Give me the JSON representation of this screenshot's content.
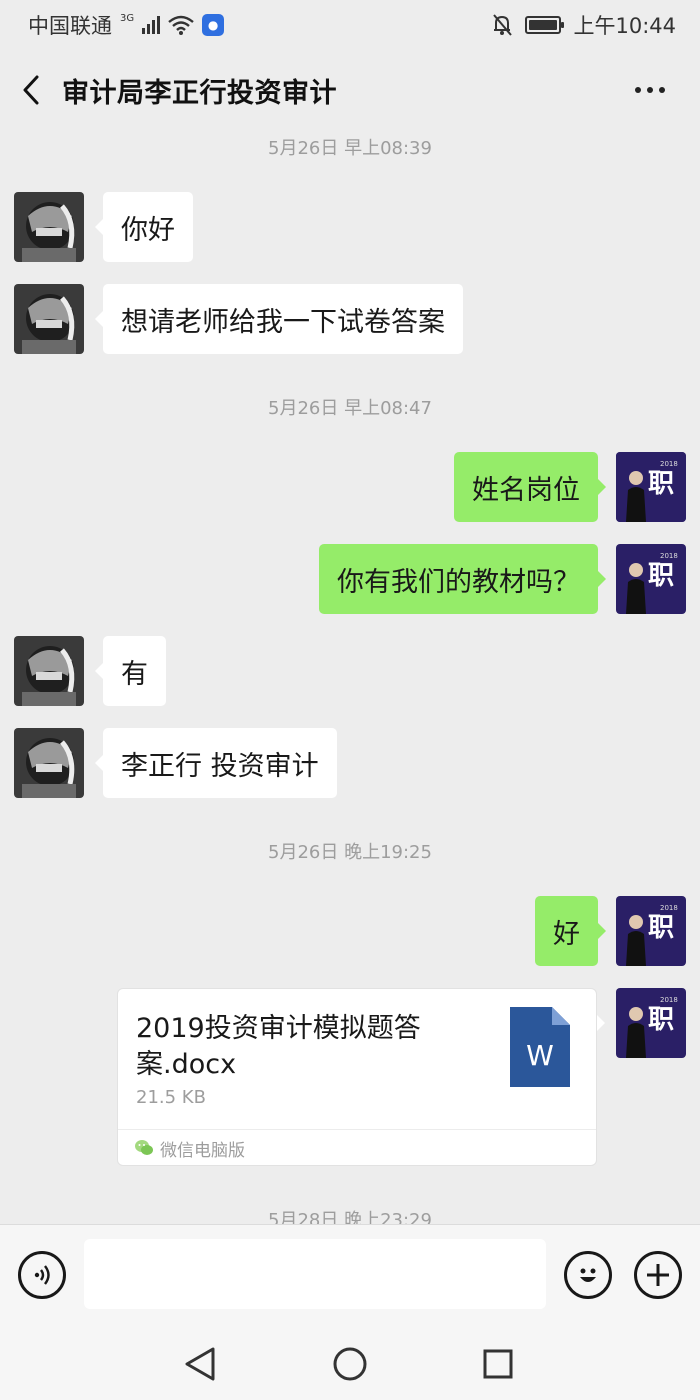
{
  "status_bar": {
    "carrier": "中国联通",
    "network": "3G",
    "time": "上午10:44"
  },
  "header": {
    "title": "审计局李正行投资审计"
  },
  "timestamps": [
    "5月26日 早上08:39",
    "5月26日 早上08:47",
    "5月26日 晚上19:25",
    "5月28日 晚上23:29"
  ],
  "messages": [
    {
      "side": "in",
      "text": "你好"
    },
    {
      "side": "in",
      "text": "想请老师给我一下试卷答案"
    },
    {
      "side": "out",
      "text": "姓名岗位"
    },
    {
      "side": "out",
      "text": "你有我们的教材吗？"
    },
    {
      "side": "in",
      "text": "有"
    },
    {
      "side": "in",
      "text": "李正行 投资审计"
    },
    {
      "side": "out",
      "text": "好"
    }
  ],
  "file_message": {
    "name": "2019投资审计模拟题答案.docx",
    "size": "21.5 KB",
    "source": "微信电脑版",
    "icon_letter": "W"
  },
  "colors": {
    "background": "#ededed",
    "bubble_out": "#95ec69",
    "bubble_in": "#ffffff",
    "word_blue": "#2b579a"
  },
  "icons": {
    "back": "chevron-left-icon",
    "more": "more-dots-icon",
    "voice": "voice-icon",
    "emoji": "emoji-icon",
    "add": "plus-icon"
  }
}
